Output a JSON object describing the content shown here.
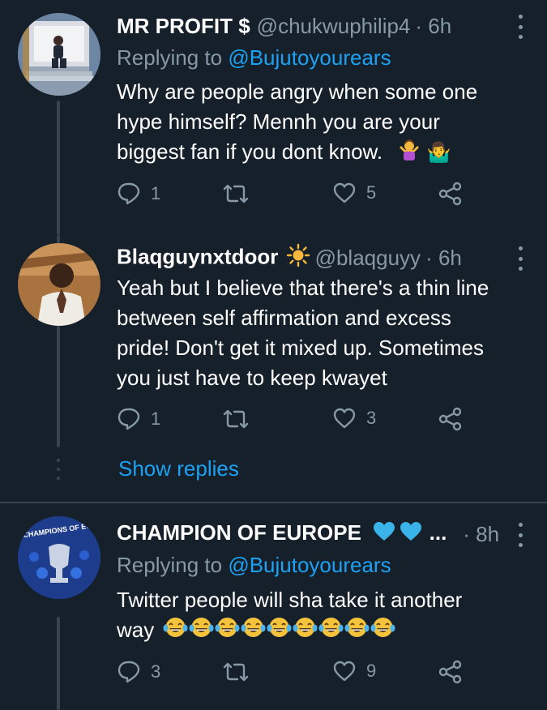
{
  "tweets": [
    {
      "name": "MR PROFIT $",
      "handle": "@chukwuphilip4",
      "time": "· 6h",
      "reply_label": "Replying to",
      "reply_mention": "@Bujutoyourears",
      "text_lines": [
        "Why are people angry when some one",
        "hype himself? Mennh you are your",
        "biggest fan if you dont know."
      ],
      "text_emoji": "🤷‍♂",
      "reply_count": "1",
      "like_count": "5",
      "avatar_icon": "avatar-man-stairs"
    },
    {
      "name": "Blaqguynxtdoor",
      "name_emoji": "☀",
      "handle": "@blaqguyy",
      "time": "· 6h",
      "text_lines": [
        "Yeah but I believe that there's a thin line",
        "between self affirmation and excess",
        "pride!  Don't get it mixed up. Sometimes",
        "you just have to keep kwayet"
      ],
      "reply_count": "1",
      "like_count": "3",
      "avatar_icon": "avatar-man-praying",
      "show_replies": "Show replies"
    },
    {
      "name": "CHAMPION OF EUROPE",
      "name_suffix": "...",
      "handle": "",
      "time": "· 8h",
      "reply_label": "Replying to",
      "reply_mention": "@Bujutoyourears",
      "text_lines": [
        "Twitter people will sha take it another",
        "way"
      ],
      "text_emoji_count": 9,
      "reply_count": "3",
      "like_count": "9",
      "avatar_icon": "avatar-champions-trophy",
      "avatar_text": "CHAMPIONS OF EUROPE"
    }
  ],
  "colors": {
    "background": "#15202b",
    "muted": "#8899a6",
    "accent": "#1da1f2",
    "divider": "#38444d",
    "heart_blue": "#3ab4e8"
  },
  "icons": [
    "reply-icon",
    "retweet-icon",
    "like-icon",
    "share-icon",
    "more-icon"
  ]
}
